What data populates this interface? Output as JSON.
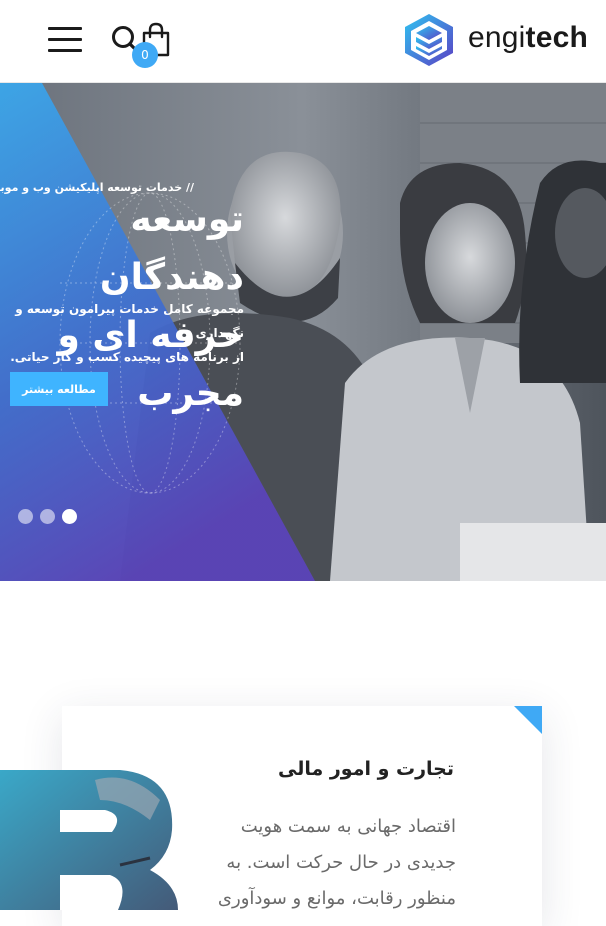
{
  "header": {
    "logo_prefix": "engi",
    "logo_suffix": "tech",
    "cart_count": "0",
    "colors": {
      "accent": "#3fa9f5",
      "text": "#1a1a1a"
    },
    "icons": [
      "menu-icon",
      "search-icon",
      "shopping-bag-icon"
    ]
  },
  "hero": {
    "eyebrow": "// خدمات توسعه اپلیکیشن وب و موبایل",
    "title_line1": "توسعه دهندگان",
    "title_line2": "حرفه ای و مجرب",
    "desc_line1": "مجموعه کامل خدمات پیرامون توسعه و نگهداری",
    "desc_line2": "از برنامه های پیچیده کسب و کار حیاتی.",
    "cta_label": "مطالعه بیشتر",
    "slides": 3,
    "active_slide": 3,
    "colors": {
      "gradient_top": "#3aa8ee",
      "gradient_bottom": "#5a44b8",
      "button": "#3fb4ff"
    }
  },
  "service_card": {
    "title": "تجارت و امور مالی",
    "text_line1": "اقتصاد جهانی به سمت هویت",
    "text_line2": "جدیدی در حال حرکت است. به",
    "text_line3": "منظور رقابت، موانع و سودآوری",
    "corner_color": "#3fa9f5"
  }
}
